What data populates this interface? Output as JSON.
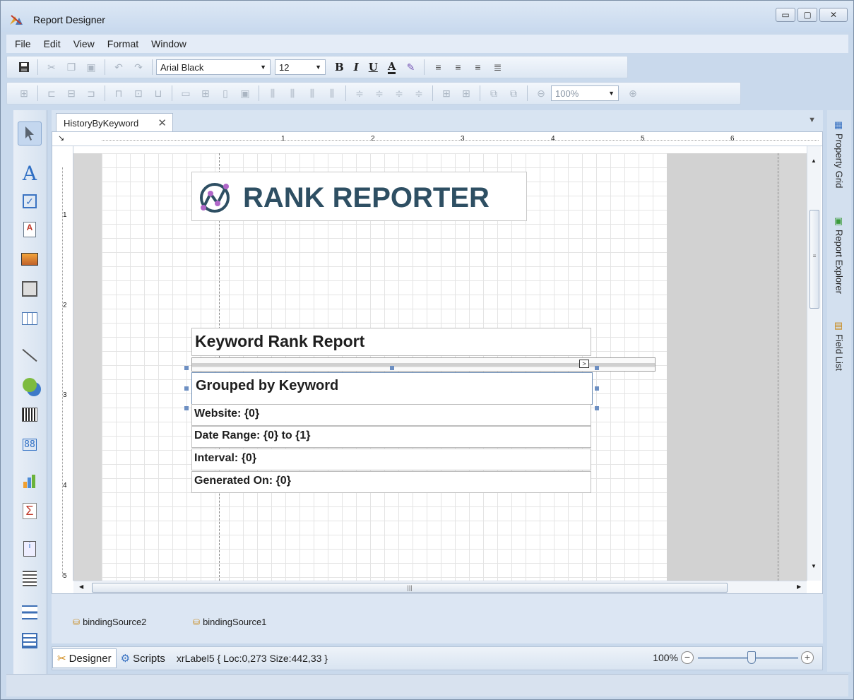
{
  "window": {
    "title": "Report Designer",
    "buttons": {
      "minimize": "▭",
      "maximize": "▢",
      "close": "✕"
    }
  },
  "menu": [
    "File",
    "Edit",
    "View",
    "Format",
    "Window"
  ],
  "toolbar": {
    "font_name": "Arial Black",
    "font_size": "12",
    "bold": "B",
    "italic": "I",
    "underline": "U",
    "font_color": "A",
    "zoom": "100%"
  },
  "tab": {
    "label": "HistoryByKeyword",
    "close": "✕"
  },
  "ruler": {
    "h_numbers": [
      "1",
      "2",
      "3",
      "4",
      "5",
      "6"
    ],
    "v_numbers": [
      "1",
      "2",
      "3",
      "4",
      "5"
    ]
  },
  "report": {
    "logo_text": "RANK REPORTER",
    "title": "Keyword Rank Report",
    "subtitle": "Grouped by Keyword",
    "info_rows": [
      "Website: {0}",
      "Date Range: {0} to {1}",
      "Interval: {0}",
      "Generated On: {0}"
    ]
  },
  "components": [
    "bindingSource2",
    "bindingSource1"
  ],
  "status": {
    "designer_tab": "Designer",
    "scripts_tab": "Scripts",
    "selection_info": "xrLabel5 { Loc:0,273 Size:442,33 }",
    "zoom": "100%"
  },
  "dock": [
    "Property Grid",
    "Report Explorer",
    "Field List"
  ],
  "colors": {
    "logo_text": "#2e4f63",
    "logo_accent": "#b066c8",
    "selection": "#6d8fc2"
  }
}
